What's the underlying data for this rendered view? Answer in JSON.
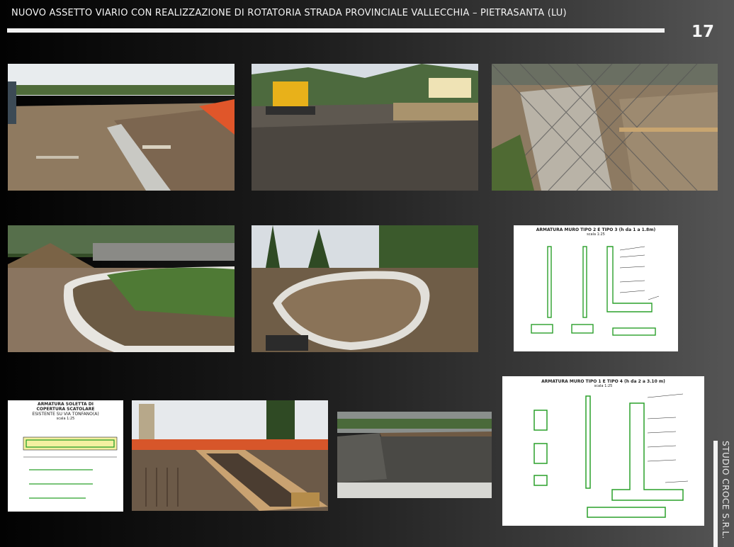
{
  "header": {
    "title": "NUOVO ASSETTO VIARIO CON REALIZZAZIONE DI ROTATORIA STRADA PROVINCIALE VALLECCHIA – PIETRASANTA (LU)",
    "page_number": "17"
  },
  "side": {
    "company": "STUDIO CROCE S.R.L."
  },
  "drawings": {
    "muro2": {
      "title": "ARMATURA MURO TIPO 2 E TIPO 3 (h da 1 a 1.8m)",
      "scale": "scala 1:25"
    },
    "soletta": {
      "title_1": "ARMATURA SOLETTA DI",
      "title_2": "COPERTURA SCATOLARE",
      "title_3": "ESISTENTE SU VIA TONFANO(A)",
      "scale": "scala 1:25"
    },
    "muro4": {
      "title": "ARMATURA MURO TIPO 1 E TIPO 4 (h da 2 a 3.10 m)",
      "scale": "scala 1:25"
    }
  },
  "colors": {
    "green_line": "#2aa02a",
    "earth": "#8a7358",
    "sky": "#dfe6ea"
  }
}
